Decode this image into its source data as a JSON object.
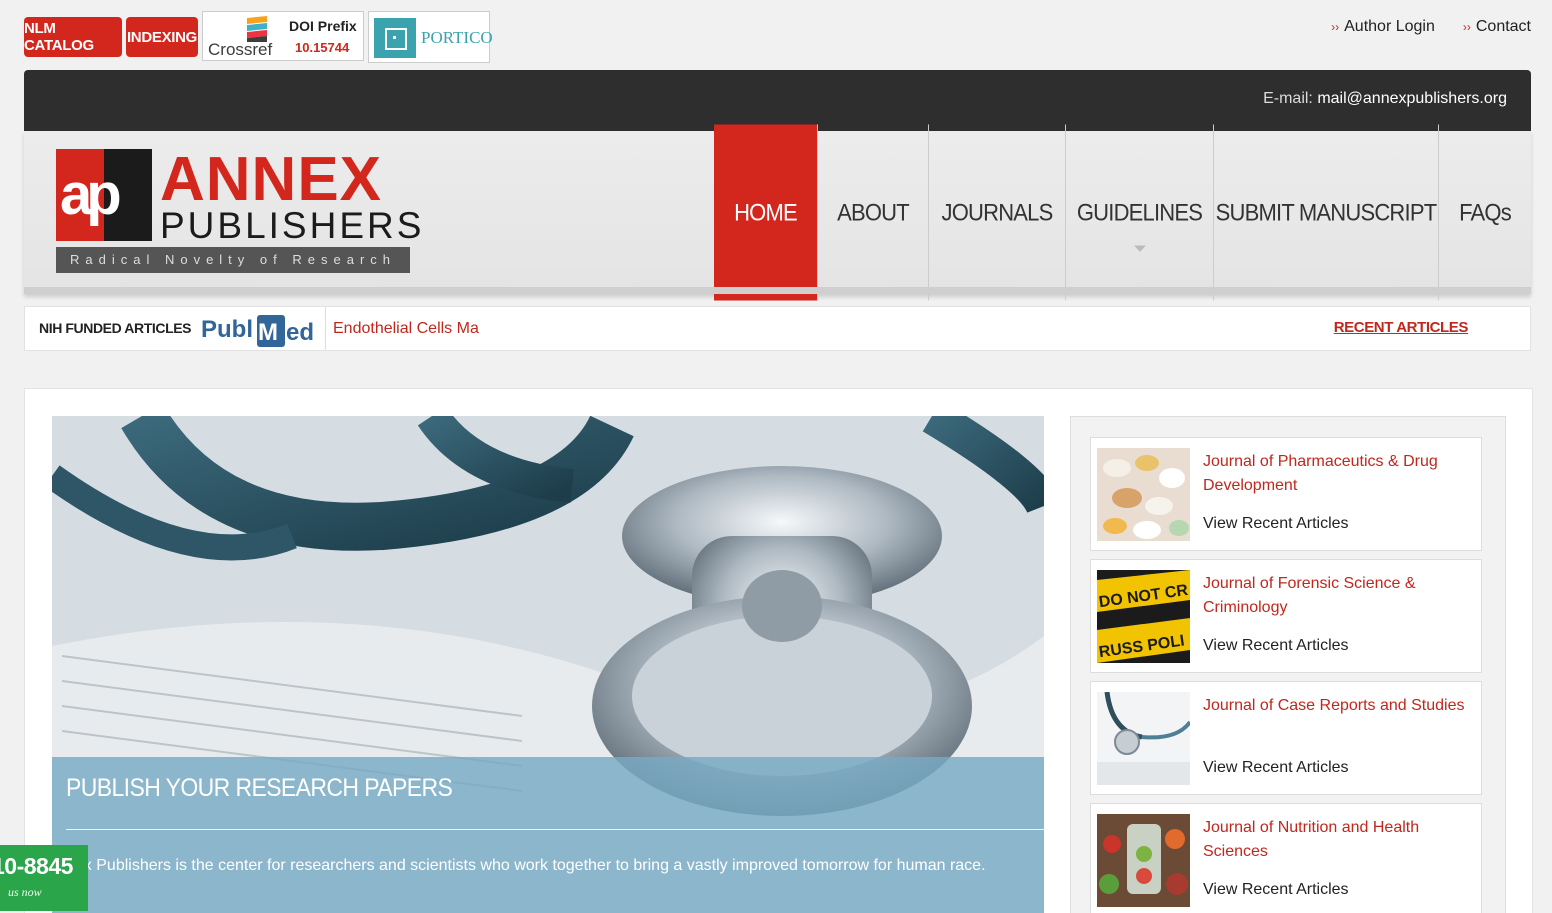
{
  "top": {
    "nlm_catalog": "NLM CATALOG",
    "indexing": "INDEXING",
    "crossref_text": "Crossref",
    "doi_prefix_label": "DOI Prefix",
    "doi_prefix_value": "10.15744",
    "portico": "PORTICO",
    "author_login": "Author Login",
    "contact": "Contact",
    "chevron": "››"
  },
  "header": {
    "email_label": "E-mail:",
    "email": "mail@annexpublishers.org"
  },
  "logo": {
    "mark": "ap",
    "name": "ANNEX",
    "sub": "PUBLISHERS",
    "tagline": "Radical Novelty of Research"
  },
  "nav": {
    "items": [
      {
        "label": "HOME"
      },
      {
        "label": "ABOUT"
      },
      {
        "label": "JOURNALS"
      },
      {
        "label": "GUIDELINES"
      },
      {
        "label": "SUBMIT MANUSCRIPT"
      },
      {
        "label": "FAQs"
      }
    ]
  },
  "ticker": {
    "nih_label": "NIH FUNDED ARTICLES",
    "pubmed": "PubMed",
    "news_text": "Endothelial Cells Ma",
    "recent_articles": "RECENT ARTICLES"
  },
  "hero": {
    "title": "PUBLISH YOUR RESEARCH PAPERS",
    "body": "nex Publishers is the center for researchers and scientists who work together to bring a vastly improved tomorrow for human race."
  },
  "journals": [
    {
      "title": "Journal of Pharmaceutics & Drug Development",
      "link": "View Recent Articles"
    },
    {
      "title": "Journal of Forensic Science & Criminology",
      "link": "View Recent Articles"
    },
    {
      "title": "Journal of Case Reports and Studies",
      "link": "View Recent Articles"
    },
    {
      "title": "Journal of Nutrition and Health Sciences",
      "link": "View Recent Articles"
    }
  ],
  "phone_widget": {
    "number": "10-8845",
    "sub": "us now"
  },
  "colors": {
    "brand_red": "#d3261c",
    "dark_band": "#2e2e2e",
    "link_red": "#c1271d",
    "phone_green": "#2aa54a",
    "portico_teal": "#3aa3ad"
  },
  "icons": [
    "crossref-logo-icon",
    "portico-logo-icon",
    "pubmed-logo-icon",
    "chevron-right-icon",
    "caret-down-icon"
  ]
}
